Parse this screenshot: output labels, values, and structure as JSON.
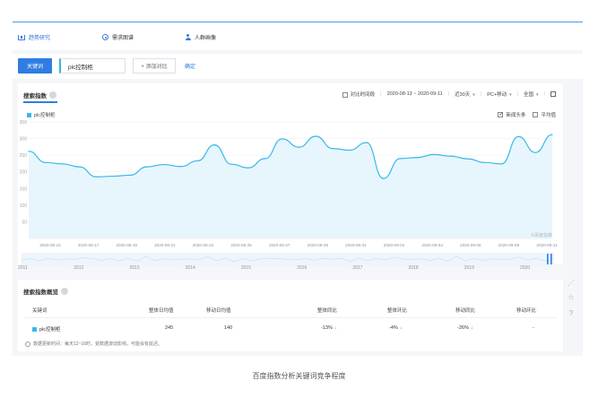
{
  "nav": {
    "items": [
      {
        "label": "趋势研究",
        "icon": "bar-chart-icon"
      },
      {
        "label": "需求图谱",
        "icon": "radio-icon"
      },
      {
        "label": "人群画像",
        "icon": "person-icon"
      }
    ]
  },
  "keywords": {
    "button_label": "关键词",
    "term": "plc控制柜",
    "add_label": "+ 添加对比",
    "confirm_label": "确定"
  },
  "search_index": {
    "title": "搜索指数",
    "compare_time": "对比时间段",
    "date_range": "2020-08-13 ~ 2020-09-11",
    "period": "近30天",
    "device": "PC+移动",
    "region": "全国",
    "news_label": "新闻头条",
    "news_checked": true,
    "avg_label": "平均值",
    "avg_checked": false,
    "watermark": "©百度指数"
  },
  "chart_data": {
    "type": "area",
    "series": [
      {
        "name": "plc控制柜",
        "color": "#39b8e8",
        "values": [
          262,
          228,
          224,
          215,
          185,
          187,
          190,
          215,
          222,
          216,
          233,
          281,
          223,
          212,
          240,
          299,
          274,
          307,
          270,
          265,
          288,
          180,
          240,
          243,
          252,
          247,
          239,
          228,
          224,
          306,
          258,
          312
        ]
      }
    ],
    "ylim": [
      0,
      350
    ],
    "yticks": [
      50,
      100,
      150,
      200,
      250,
      300,
      350
    ],
    "xticks": [
      "2020-08-15",
      "2020-08-17",
      "2020-08-19",
      "2020-08-21",
      "2020-08-23",
      "2020-08-25",
      "2020-08-27",
      "2020-08-29",
      "2020-08-31",
      "2020-09-02",
      "2020-09-04",
      "2020-09-06",
      "2020-09-08",
      "2020-09-11"
    ],
    "timeline_years": [
      "2011",
      "2012",
      "2013",
      "2014",
      "2015",
      "2016",
      "2017",
      "2018",
      "2019",
      "2020"
    ]
  },
  "overview": {
    "title": "搜索指数概览",
    "headers": [
      "关键词",
      "整体日均值",
      "移动日均值",
      "整体同比",
      "整体环比",
      "移动同比",
      "移动环比"
    ],
    "row": {
      "keyword": "plc控制柜",
      "overall_avg": "245",
      "mobile_avg": "140",
      "overall_yoy": "-13%",
      "overall_mom": "-4%",
      "mobile_yoy": "-26%",
      "mobile_mom": "-"
    },
    "note": "数据更新时间：每天12~16时，受数据波动影响，可能会有延迟。"
  },
  "caption": "百度指数分析关键词竞争程度"
}
